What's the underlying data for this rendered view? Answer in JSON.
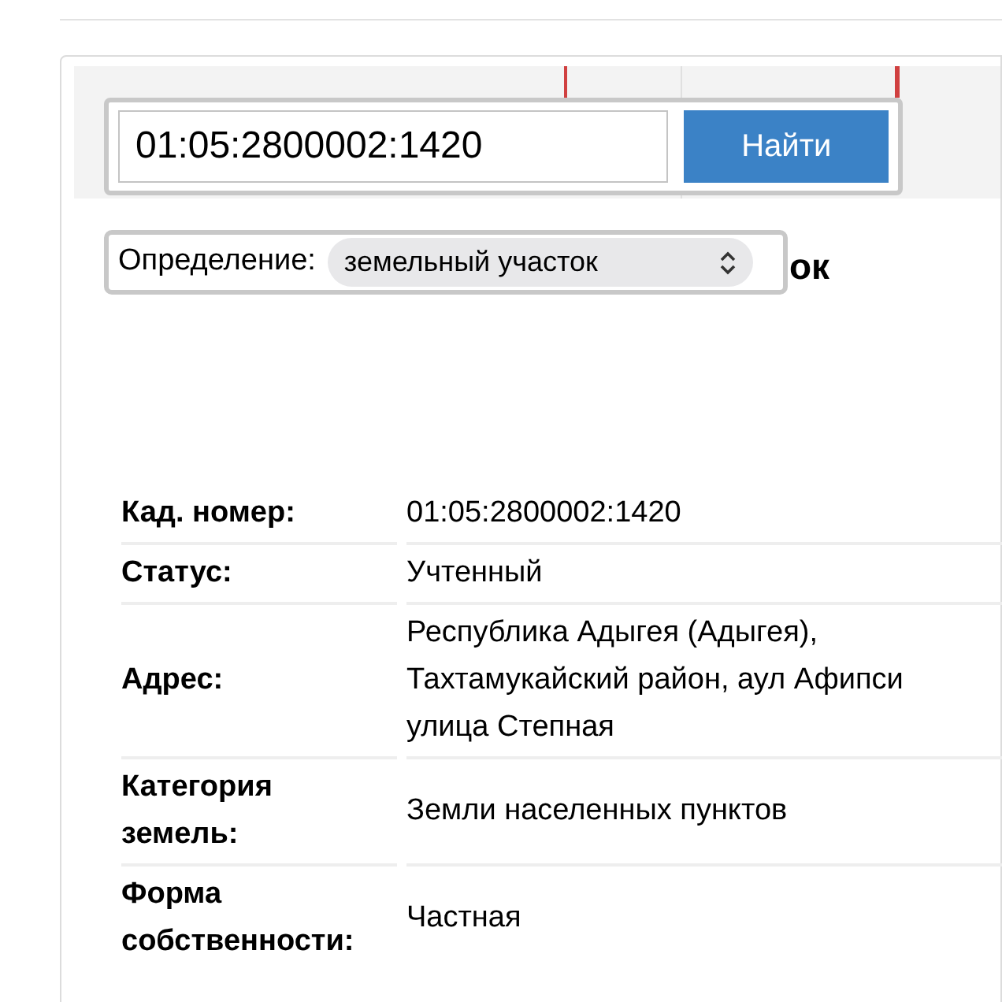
{
  "search": {
    "value": "01:05:2800002:1420",
    "button": "Найти"
  },
  "definition": {
    "label": "Определение:",
    "value": "земельный участок"
  },
  "heading_fragment": "ок",
  "rows": [
    {
      "label": "Кад. номер:",
      "value": "01:05:2800002:1420"
    },
    {
      "label": "Статус:",
      "value": "Учтенный"
    },
    {
      "label": "Адрес:",
      "value": "Республика Адыгея (Адыгея),\nТахтамукайский район, аул Афипси\nулица Степная"
    },
    {
      "label": "Категория земель:",
      "value": "Земли населенных пунктов"
    },
    {
      "label": "Форма собственности:",
      "value": "Частная"
    }
  ]
}
